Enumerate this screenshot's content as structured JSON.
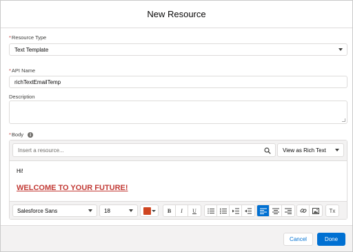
{
  "modal": {
    "title": "New Resource"
  },
  "resource_type": {
    "label": "Resource Type",
    "required_mark": "*",
    "value": "Text Template"
  },
  "api_name": {
    "label": "API Name",
    "required_mark": "*",
    "value": "richTextEmailTemp"
  },
  "description": {
    "label": "Description",
    "value": ""
  },
  "body": {
    "label": "Body",
    "required_mark": "*",
    "info_icon": "info-icon",
    "search_placeholder": "Insert a resource...",
    "view_mode": "View as Rich Text",
    "content": {
      "line1": "Hi!",
      "line2": "WELCOME TO YOUR FUTURE!",
      "line2_color": "#c23934"
    },
    "toolbar": {
      "font_family": "Salesforce Sans",
      "font_size": "18",
      "text_color": "#cf4520",
      "bold": "B",
      "italic": "I",
      "underline": "U",
      "clear_format": "Tx"
    }
  },
  "footer": {
    "cancel_label": "Cancel",
    "done_label": "Done"
  },
  "colors": {
    "accent": "#0070d2",
    "required": "#c23934"
  }
}
